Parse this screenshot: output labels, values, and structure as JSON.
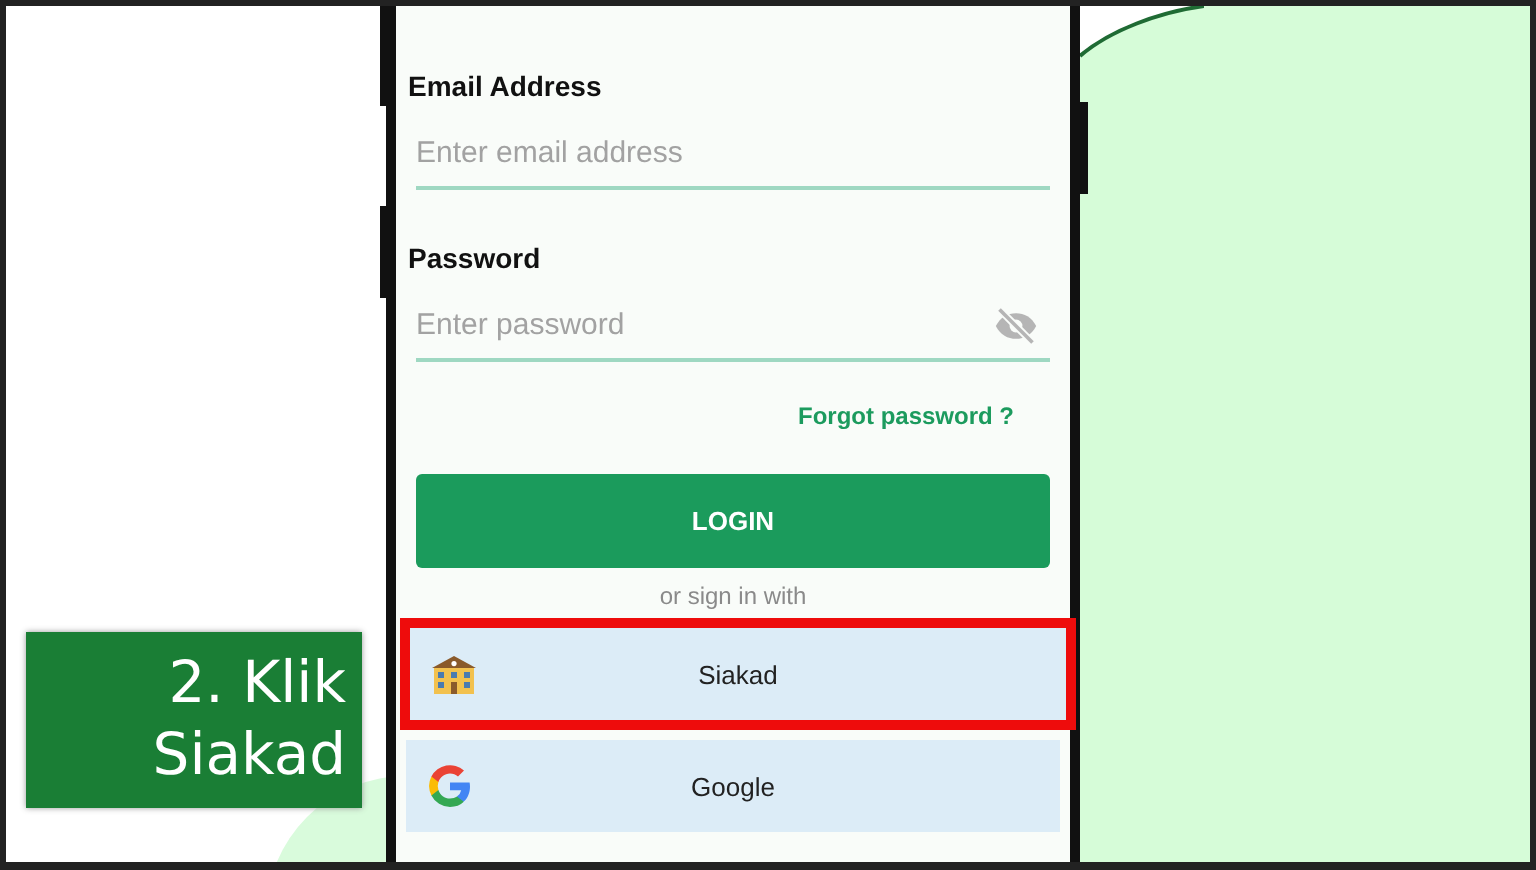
{
  "caption": {
    "text": "2. Klik Siakad"
  },
  "form": {
    "email": {
      "label": "Email Address",
      "placeholder": "Enter email address"
    },
    "password": {
      "label": "Password",
      "placeholder": "Enter password",
      "visible": false
    },
    "forgot_link": "Forgot password ?",
    "login_button": "LOGIN",
    "divider_text": "or sign in with"
  },
  "providers": [
    {
      "kind": "siakad",
      "label": "Siakad",
      "highlighted": true
    },
    {
      "kind": "google",
      "label": "Google",
      "highlighted": false
    }
  ]
}
